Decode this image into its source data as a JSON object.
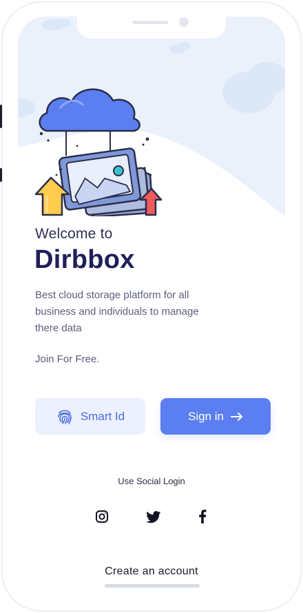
{
  "welcome": {
    "line1": "Welcome to",
    "brand": "Dirbbox",
    "description": "Best cloud storage platform for all business and individuals to manage there data",
    "join": "Join For Free."
  },
  "buttons": {
    "smart_id": "Smart Id",
    "sign_in": "Sign in"
  },
  "social": {
    "label": "Use Social Login",
    "icons": [
      "instagram-icon",
      "twitter-icon",
      "facebook-icon"
    ]
  },
  "footer": {
    "create_account": "Create an account"
  },
  "colors": {
    "primary": "#5b7ff0",
    "brand_text": "#1f1f5a",
    "smart_bg": "#edf1fd",
    "hero_bg": "#e9f0fb"
  }
}
